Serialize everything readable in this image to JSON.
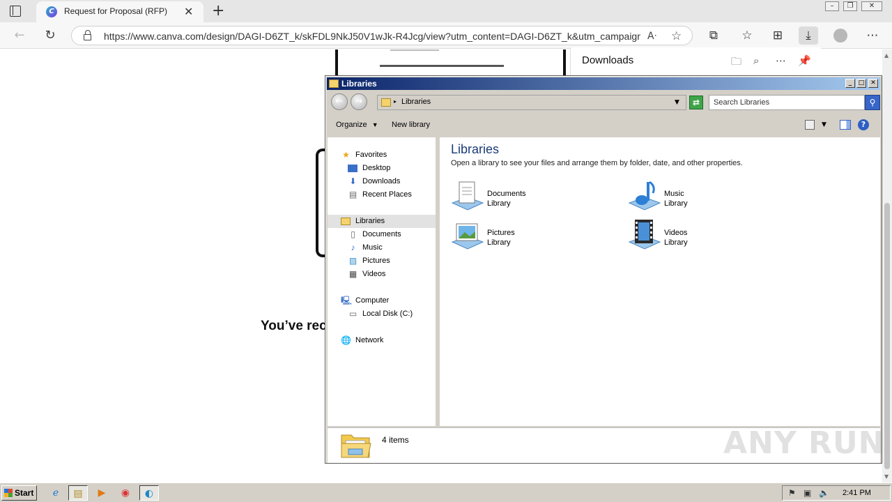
{
  "browser": {
    "tab_title": "Request for Proposal (RFP)",
    "tab_favicon": "C",
    "url": "https://www.canva.com/design/DAGI-D6ZT_k/skFDL9NkJ50V1wJk-R4Jcg/view?utm_content=DAGI-D6ZT_k&utm_campaign...",
    "downloads_title": "Downloads"
  },
  "page": {
    "received_text": "You’ve rec"
  },
  "explorer": {
    "title": "Libraries",
    "address": "Libraries",
    "search_placeholder": "Search Libraries",
    "toolbar": {
      "organize": "Organize",
      "new_library": "New library"
    },
    "nav": {
      "favorites": "Favorites",
      "desktop": "Desktop",
      "downloads": "Downloads",
      "recent_places": "Recent Places",
      "libraries": "Libraries",
      "documents": "Documents",
      "music": "Music",
      "pictures": "Pictures",
      "videos": "Videos",
      "computer": "Computer",
      "local_disk": "Local Disk (C:)",
      "network": "Network"
    },
    "heading": "Libraries",
    "description": "Open a library to see your files and arrange them by folder, date, and other properties.",
    "libraries": [
      {
        "name": "Documents",
        "type": "Library",
        "icon": "documents-library-icon"
      },
      {
        "name": "Music",
        "type": "Library",
        "icon": "music-library-icon"
      },
      {
        "name": "Pictures",
        "type": "Library",
        "icon": "pictures-library-icon"
      },
      {
        "name": "Videos",
        "type": "Library",
        "icon": "videos-library-icon"
      }
    ],
    "status": "4 items"
  },
  "taskbar": {
    "start_label": "Start",
    "clock": "2:41 PM"
  },
  "watermark": "ANY RUN"
}
